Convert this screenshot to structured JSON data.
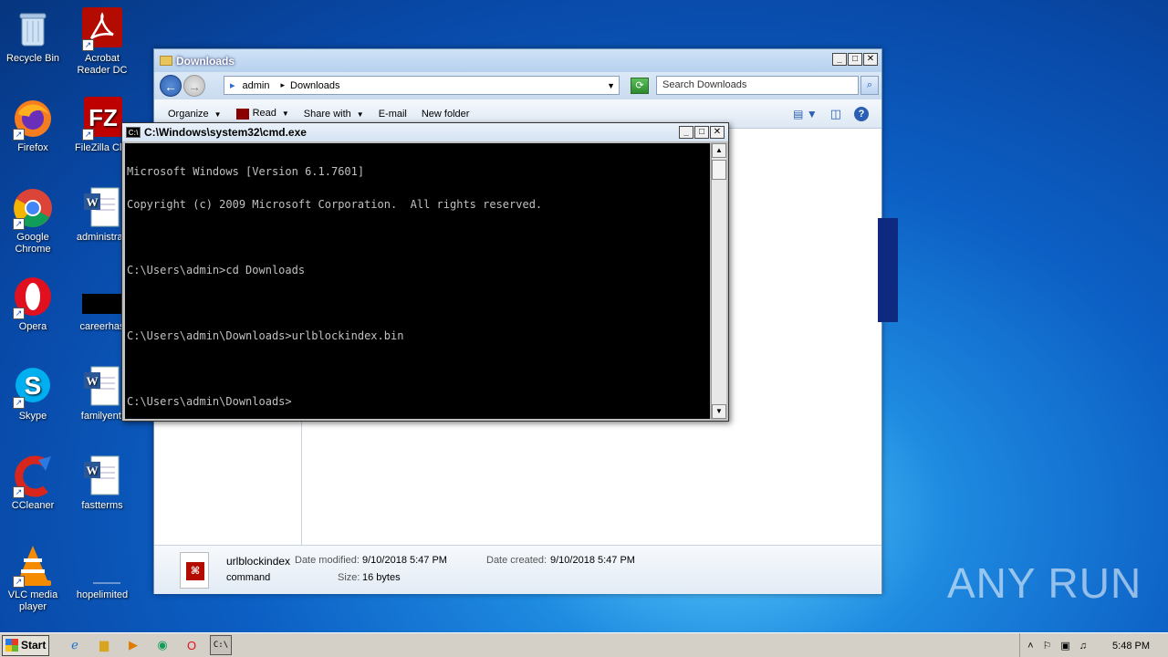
{
  "desktop": {
    "icons": [
      {
        "label": "Recycle Bin",
        "icon": "recycle-bin-icon"
      },
      {
        "label": "Acrobat Reader DC",
        "icon": "acrobat-icon"
      },
      {
        "label": "Firefox",
        "icon": "firefox-icon"
      },
      {
        "label": "FileZilla Clie",
        "icon": "filezilla-icon"
      },
      {
        "label": "Google Chrome",
        "icon": "chrome-icon"
      },
      {
        "label": "administrati",
        "icon": "word-doc-icon"
      },
      {
        "label": "Opera",
        "icon": "opera-icon"
      },
      {
        "label": "careerhas",
        "icon": "blank-file-icon"
      },
      {
        "label": "Skype",
        "icon": "skype-icon"
      },
      {
        "label": "familyenti",
        "icon": "word-doc-icon"
      },
      {
        "label": "CCleaner",
        "icon": "ccleaner-icon"
      },
      {
        "label": "fastterms",
        "icon": "word-doc-icon"
      },
      {
        "label": "VLC media player",
        "icon": "vlc-icon"
      },
      {
        "label": "hopelimited",
        "icon": "blank-file-icon"
      }
    ]
  },
  "explorer": {
    "title": "Downloads",
    "breadcrumb": [
      "admin",
      "Downloads"
    ],
    "search_placeholder": "Search Downloads",
    "toolbar": {
      "organize": "Organize",
      "read": "Read",
      "share_with": "Share with",
      "email": "E-mail",
      "new_folder": "New folder"
    },
    "details": {
      "file_name": "urlblockindex",
      "file_type": "command",
      "date_modified_label": "Date modified:",
      "date_modified": "9/10/2018 5:47 PM",
      "date_created_label": "Date created:",
      "date_created": "9/10/2018 5:47 PM",
      "size_label": "Size:",
      "size": "16 bytes"
    }
  },
  "cmd": {
    "title": "C:\\Windows\\system32\\cmd.exe",
    "lines": [
      "Microsoft Windows [Version 6.1.7601]",
      "Copyright (c) 2009 Microsoft Corporation.  All rights reserved.",
      "",
      "C:\\Users\\admin>cd Downloads",
      "",
      "C:\\Users\\admin\\Downloads>urlblockindex.bin",
      "",
      "C:\\Users\\admin\\Downloads>"
    ]
  },
  "taskbar": {
    "start_label": "Start",
    "clock": "5:48 PM"
  },
  "watermark": "ANY RUN",
  "colors": {
    "desktop_bg": "#0a5cc4",
    "cmd_bg": "#000000",
    "cmd_fg": "#c0c0c0",
    "taskbar_bg": "#d4d0c8"
  }
}
